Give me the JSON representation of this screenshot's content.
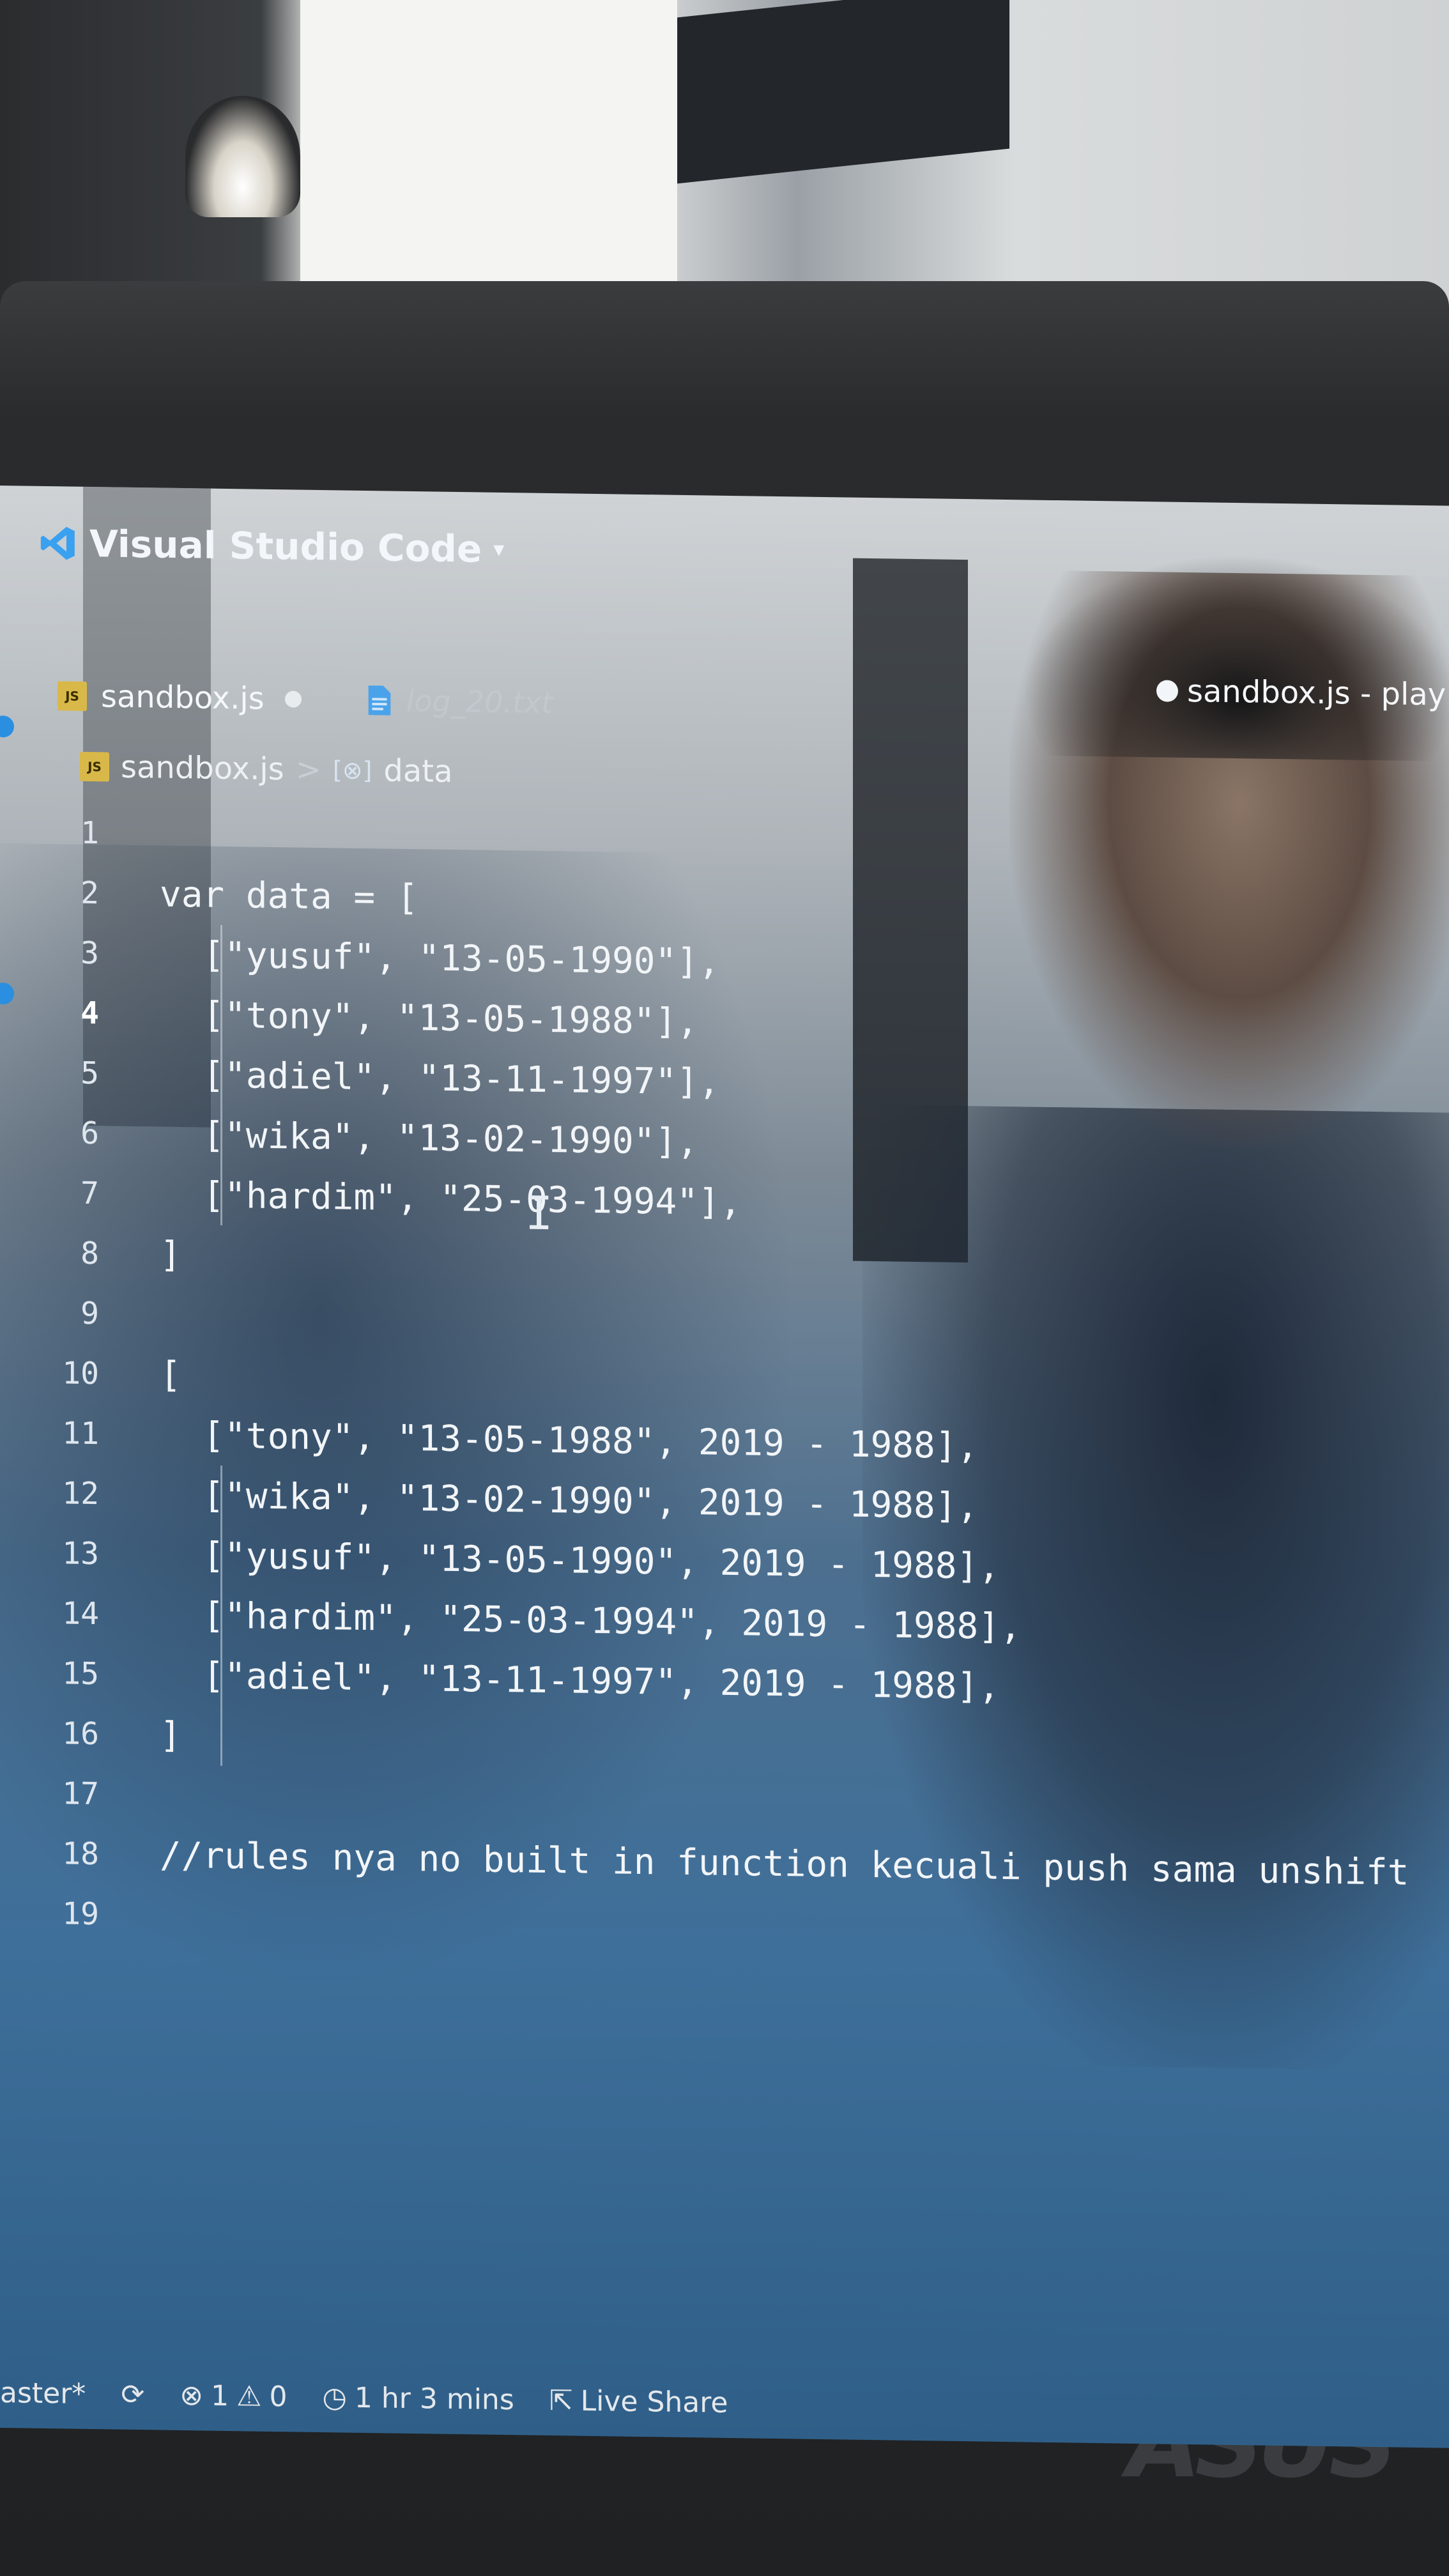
{
  "app": {
    "title": "Visual Studio Code"
  },
  "tabs": [
    {
      "name": "sandbox.js",
      "badge": "JS",
      "modified": true
    },
    {
      "name": "log_20.txt"
    }
  ],
  "right_tab": {
    "label": "sandbox.js - play"
  },
  "breadcrumb": {
    "file": "sandbox.js",
    "separator": ">",
    "symbol": "data",
    "badge": "JS"
  },
  "editor": {
    "lines": [
      {
        "n": "1",
        "text": ""
      },
      {
        "n": "2",
        "text": "var data = ["
      },
      {
        "n": "3",
        "text": "  [\"yusuf\", \"13-05-1990\"],"
      },
      {
        "n": "4",
        "text": "  [\"tony\", \"13-05-1988\"],"
      },
      {
        "n": "5",
        "text": "  [\"adiel\", \"13-11-1997\"],"
      },
      {
        "n": "6",
        "text": "  [\"wika\", \"13-02-1990\"],"
      },
      {
        "n": "7",
        "text": "  [\"hardim\", \"25-03-1994\"],"
      },
      {
        "n": "8",
        "text": "]"
      },
      {
        "n": "9",
        "text": ""
      },
      {
        "n": "10",
        "text": "["
      },
      {
        "n": "11",
        "text": "  [\"tony\", \"13-05-1988\", 2019 - 1988],"
      },
      {
        "n": "12",
        "text": "  [\"wika\", \"13-02-1990\", 2019 - 1988],"
      },
      {
        "n": "13",
        "text": "  [\"yusuf\", \"13-05-1990\", 2019 - 1988],"
      },
      {
        "n": "14",
        "text": "  [\"hardim\", \"25-03-1994\", 2019 - 1988],"
      },
      {
        "n": "15",
        "text": "  [\"adiel\", \"13-11-1997\", 2019 - 1988],"
      },
      {
        "n": "16",
        "text": "]"
      },
      {
        "n": "17",
        "text": ""
      },
      {
        "n": "18",
        "text": "//rules nya no built in function kecuali push sama unshift"
      },
      {
        "n": "19",
        "text": ""
      }
    ],
    "active_line": "4"
  },
  "status": {
    "branch": "aster*",
    "errors": "1",
    "warnings": "0",
    "time": "1 hr 3 mins",
    "live_share": "Live Share"
  },
  "brand": "ASUS"
}
